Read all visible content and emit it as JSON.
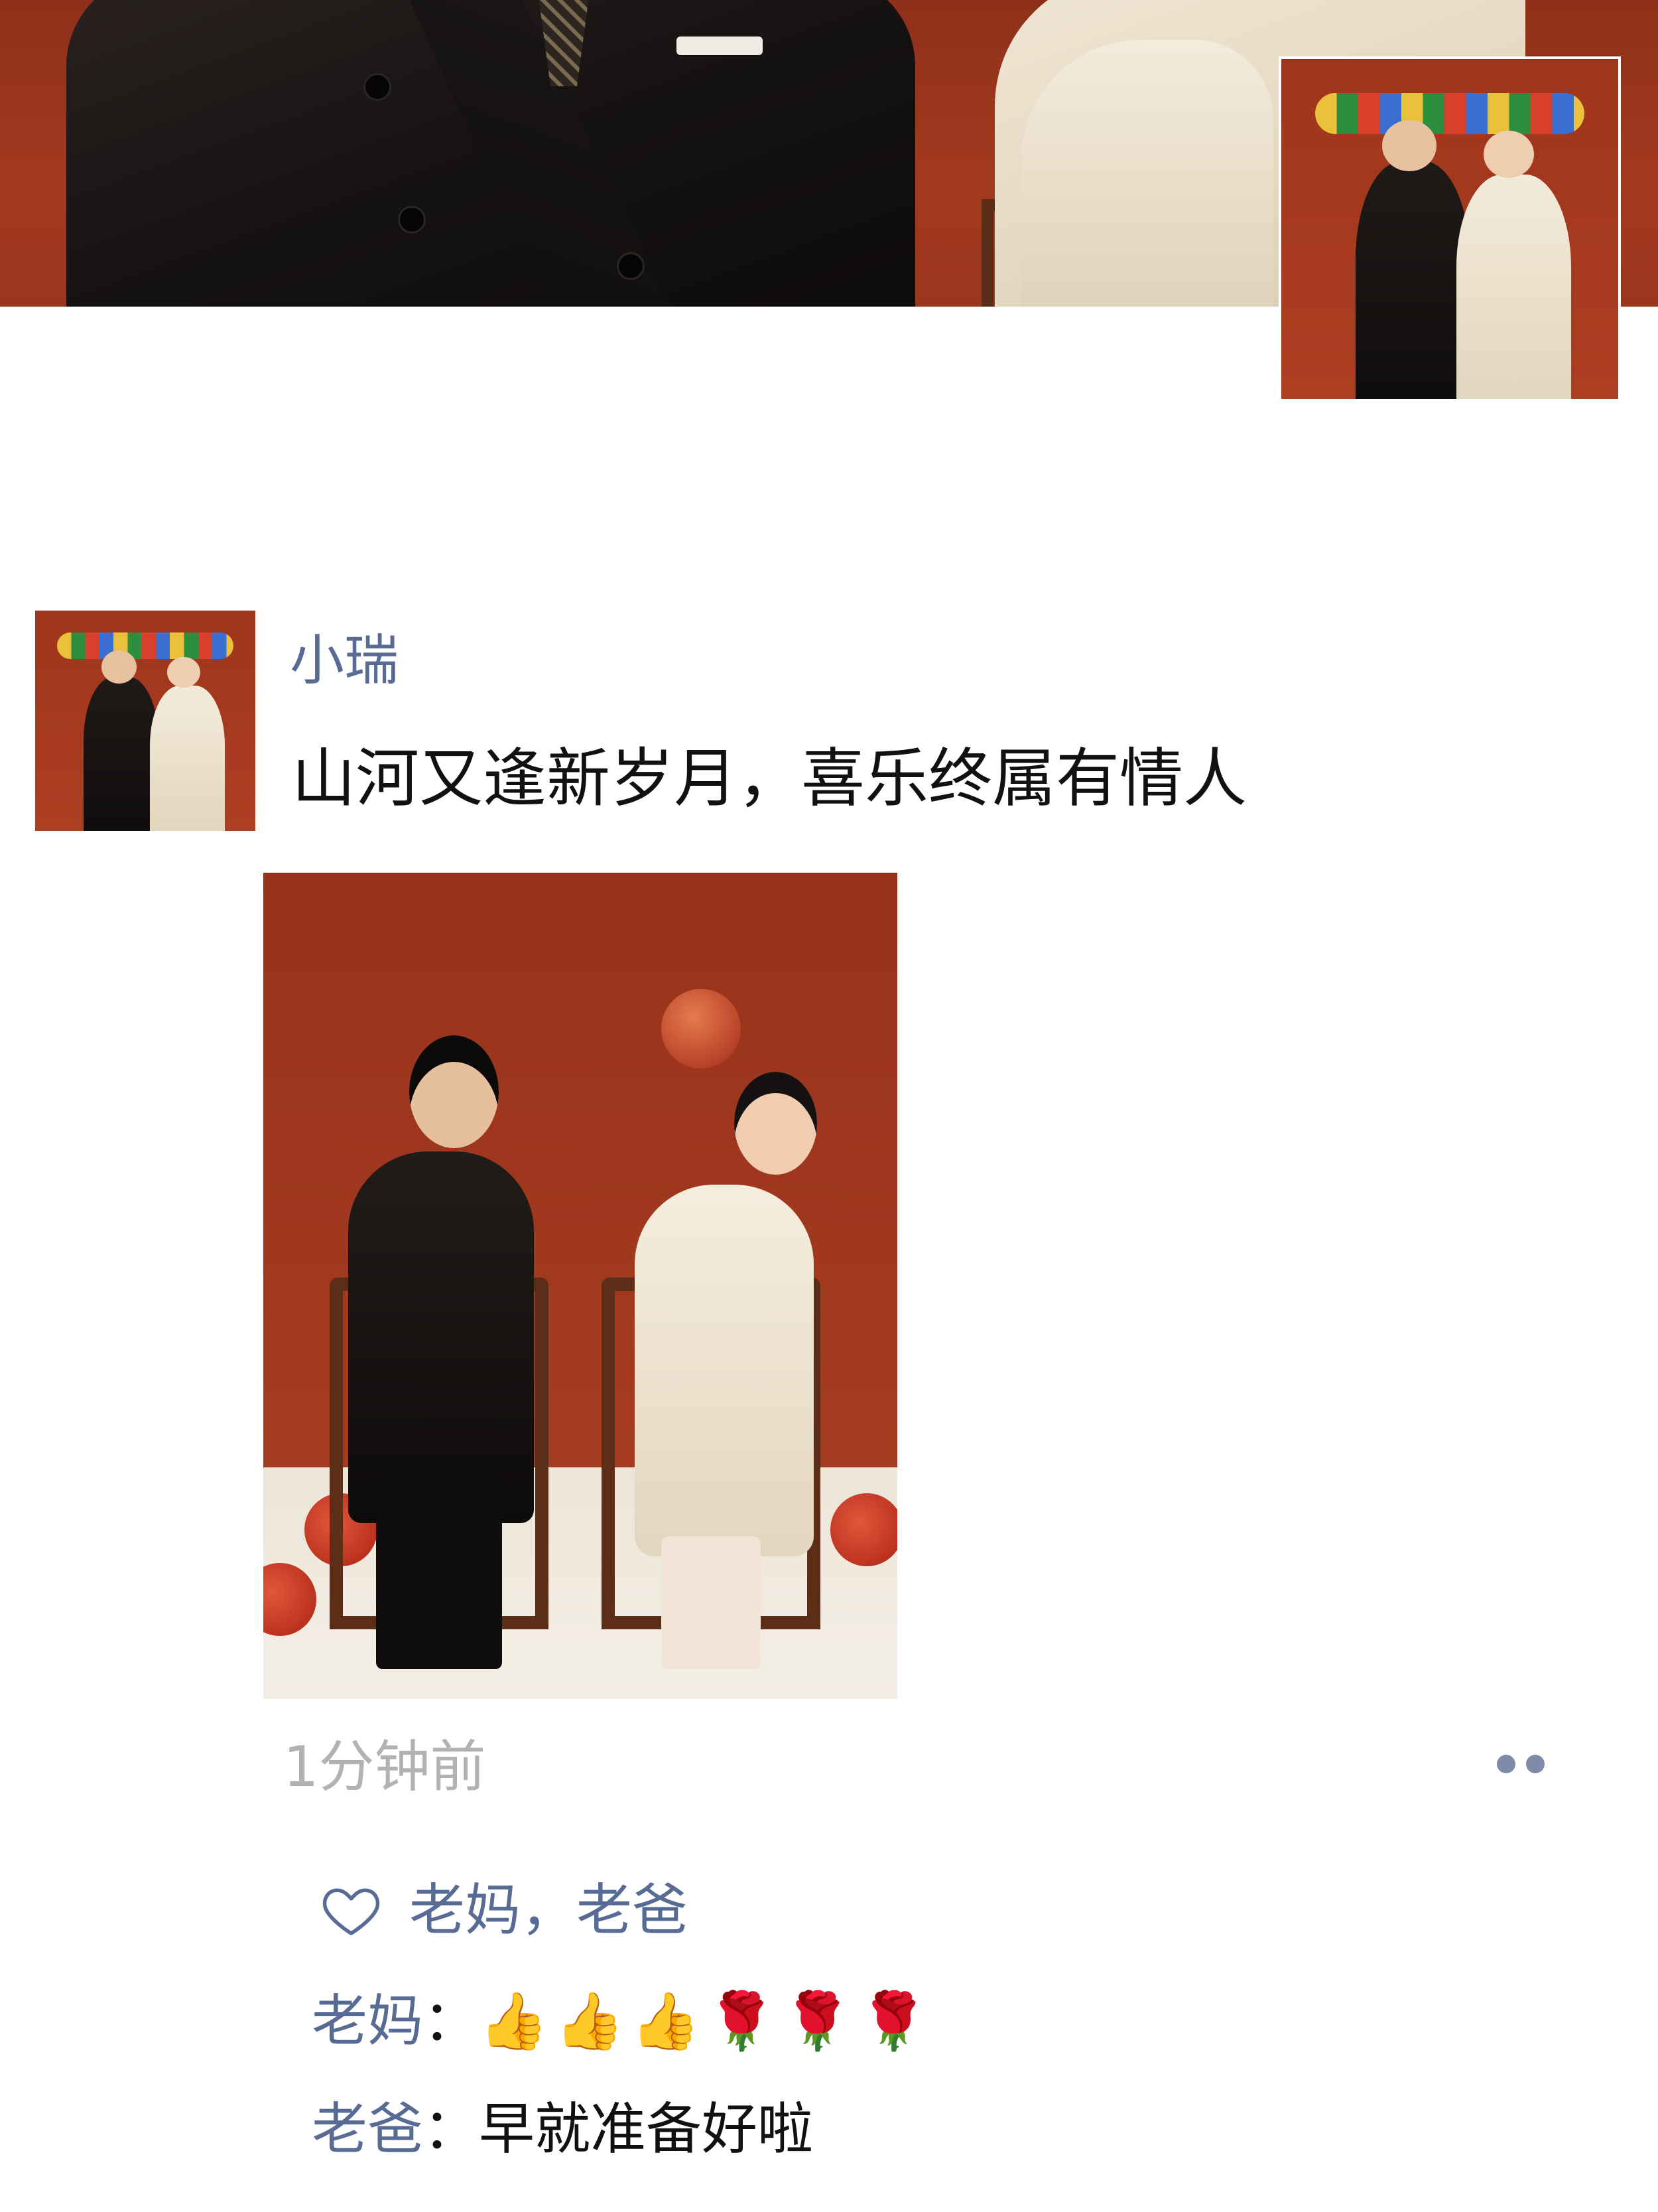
{
  "post": {
    "username": "小瑞",
    "text": "山河又逢新岁月，喜乐终属有情人",
    "timestamp": "1分钟前"
  },
  "likes": {
    "names": "老妈，老爸"
  },
  "comments": [
    {
      "author": "老妈",
      "separator": "：",
      "emojis": [
        "👍",
        "👍",
        "👍",
        "🌹",
        "🌹",
        "🌹"
      ]
    },
    {
      "author": "老爸",
      "separator": "：",
      "text": "早就准备好啦"
    }
  ],
  "icons": {
    "like": "heart-outline-icon",
    "more": "more-dots-icon"
  },
  "colors": {
    "name_link": "#576b95",
    "timestamp": "#b2b2b2",
    "photo_backdrop": "#a33a1f"
  }
}
